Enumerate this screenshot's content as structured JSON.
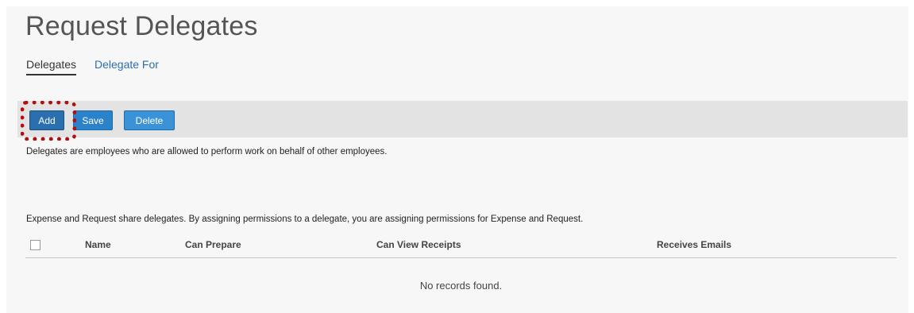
{
  "page": {
    "title": "Request Delegates"
  },
  "tabs": [
    {
      "label": "Delegates",
      "active": true
    },
    {
      "label": "Delegate For",
      "active": false
    }
  ],
  "toolbar": {
    "add_label": "Add",
    "save_label": "Save",
    "delete_label": "Delete"
  },
  "notes": {
    "description": "Delegates are employees who are allowed to perform work on behalf of other employees.",
    "shared_info": "Expense and Request share delegates. By assigning permissions to a delegate, you are assigning permissions for Expense and Request."
  },
  "table": {
    "columns": [
      "Name",
      "Can Prepare",
      "Can View Receipts",
      "Receives Emails"
    ],
    "empty_message": "No records found."
  },
  "colors": {
    "button_primary": "#2c82c9",
    "highlight": "#b01010",
    "link": "#2d6ea8",
    "toolbar_bg": "#e3e3e3"
  }
}
